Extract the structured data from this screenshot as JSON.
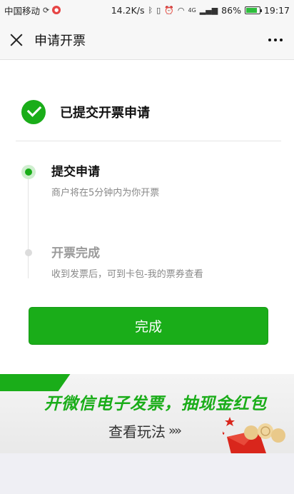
{
  "status_bar": {
    "carrier": "中国移动",
    "speed": "14.2K/s",
    "network": "4G",
    "battery_percent": "86%",
    "battery_level": 0.86,
    "time": "19:17",
    "icons": [
      "carrier-badge-icon",
      "bluetooth-icon",
      "vibrate-icon",
      "alarm-icon",
      "wifi-icon",
      "signal-icon",
      "battery-icon"
    ]
  },
  "navbar": {
    "title": "申请开票",
    "close_icon": "close-icon",
    "more_icon": "more-icon"
  },
  "result": {
    "title": "已提交开票申请",
    "icon": "check-circle-icon",
    "accent": "#1aad19"
  },
  "steps": [
    {
      "title": "提交申请",
      "desc": "商户将在5分钟内为你开票",
      "state": "active"
    },
    {
      "title": "开票完成",
      "desc": "收到发票后，可到卡包-我的票券查看",
      "state": "pending"
    }
  ],
  "done_button": {
    "label": "完成"
  },
  "banner": {
    "headline": "开微信电子发票，抽现金红包",
    "link": "查看玩法",
    "arrow": "»»"
  }
}
